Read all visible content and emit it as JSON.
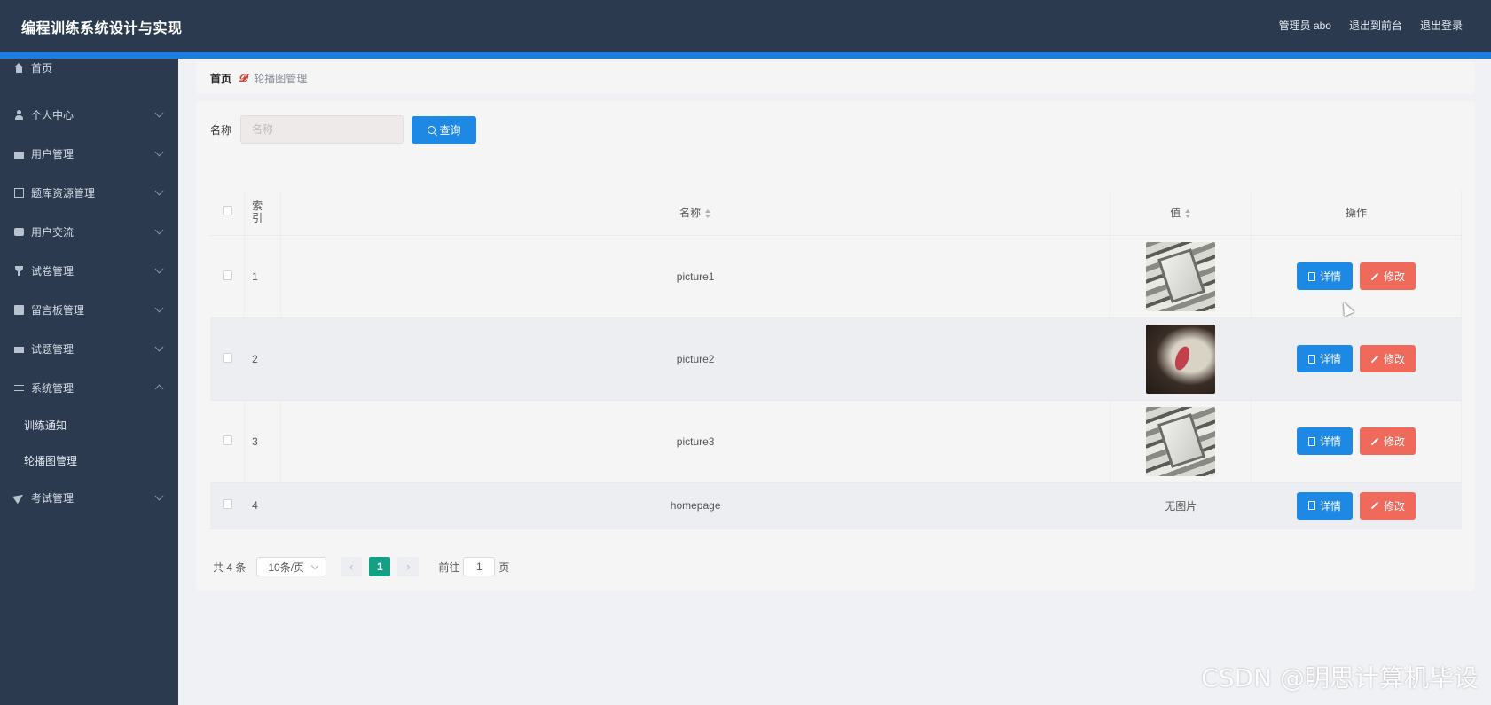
{
  "header": {
    "title": "编程训练系统设计与实现",
    "admin_label": "管理员 abo",
    "front_label": "退出到前台",
    "logout_label": "退出登录"
  },
  "sidebar": {
    "items": [
      {
        "label": "首页",
        "icon": "home-icon",
        "expandable": false
      },
      {
        "label": "个人中心",
        "icon": "user-icon",
        "expandable": true
      },
      {
        "label": "用户管理",
        "icon": "briefcase-icon",
        "expandable": true
      },
      {
        "label": "题库资源管理",
        "icon": "copy-icon",
        "expandable": true
      },
      {
        "label": "用户交流",
        "icon": "chat-icon",
        "expandable": true
      },
      {
        "label": "试卷管理",
        "icon": "trophy-icon",
        "expandable": true
      },
      {
        "label": "留言板管理",
        "icon": "clipboard-icon",
        "expandable": true
      },
      {
        "label": "试题管理",
        "icon": "ticket-icon",
        "expandable": true
      },
      {
        "label": "系统管理",
        "icon": "sliders-icon",
        "expandable": true,
        "expanded": true
      },
      {
        "label": "考试管理",
        "icon": "send-icon",
        "expandable": true
      }
    ],
    "sub_items": [
      "训练通知",
      "轮播图管理"
    ]
  },
  "breadcrumb": {
    "home": "首页",
    "separator": "𝓓",
    "current": "轮播图管理"
  },
  "search": {
    "label": "名称",
    "placeholder": "名称",
    "button": "查询"
  },
  "table": {
    "headers": {
      "index": "索\n引",
      "name": "名称",
      "value": "值",
      "actions": "操作"
    },
    "rows": [
      {
        "index": "1",
        "name": "picture1",
        "value": "image"
      },
      {
        "index": "2",
        "name": "picture2",
        "value": "image"
      },
      {
        "index": "3",
        "name": "picture3",
        "value": "image"
      },
      {
        "index": "4",
        "name": "homepage",
        "value": "无图片"
      }
    ],
    "detail_label": "详情",
    "edit_label": "修改"
  },
  "pagination": {
    "total": "共 4 条",
    "page_size": "10条/页",
    "current_page": "1",
    "prev": "‹",
    "next": "›",
    "goto_label": "前往",
    "goto_value": "1",
    "page_unit": "页"
  },
  "colors": {
    "header_bg": "#2b3a4e",
    "accent_blue": "#1e88e5",
    "edit_red": "#f06a5c",
    "page_active": "#13a085"
  },
  "watermark": "CSDN @明思计算机毕设"
}
